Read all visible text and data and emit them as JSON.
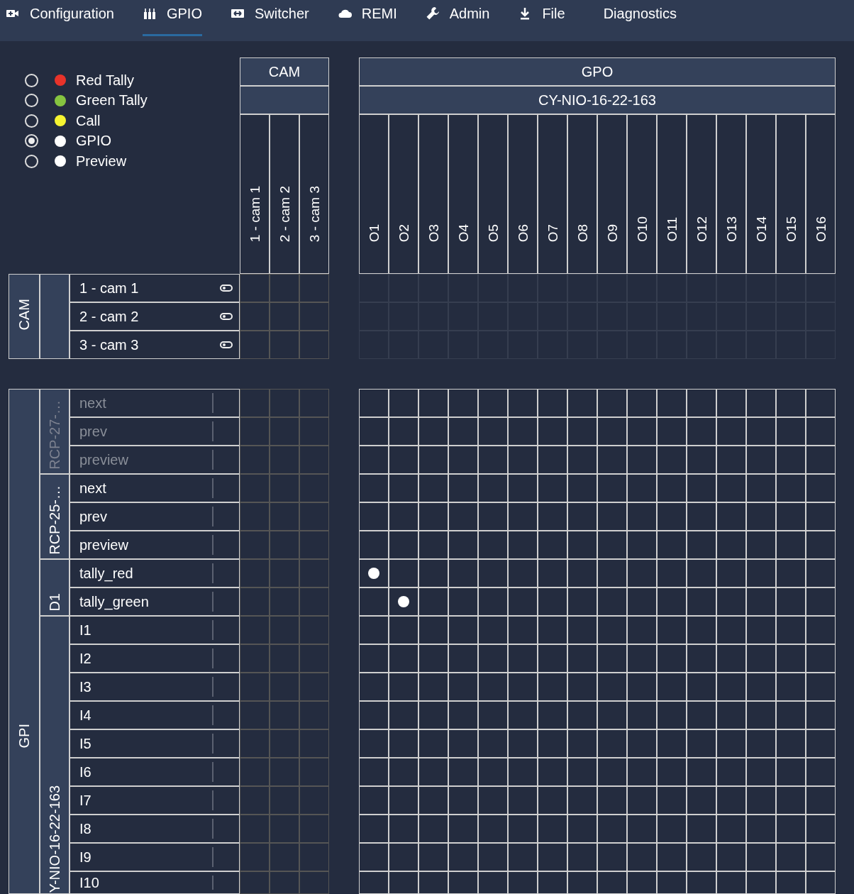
{
  "nav": [
    {
      "label": "Configuration",
      "selected": false
    },
    {
      "label": "GPIO",
      "selected": true
    },
    {
      "label": "Switcher",
      "selected": false
    },
    {
      "label": "REMI",
      "selected": false
    },
    {
      "label": "Admin",
      "selected": false
    },
    {
      "label": "File",
      "selected": false
    },
    {
      "label": "Diagnostics",
      "selected": false
    }
  ],
  "legend": [
    {
      "label": "Red Tally",
      "color": "#e8332a",
      "selected": false
    },
    {
      "label": "Green Tally",
      "color": "#86c440",
      "selected": false
    },
    {
      "label": "Call",
      "color": "#f6f531",
      "selected": false
    },
    {
      "label": "GPIO",
      "color": "#ffffff",
      "selected": true
    },
    {
      "label": "Preview",
      "color": "#ffffff",
      "selected": false
    }
  ],
  "cam_columns": {
    "title": "CAM",
    "columns": [
      "1 - cam 1",
      "2 - cam 2",
      "3 - cam 3"
    ]
  },
  "gpo": {
    "title": "GPO",
    "device": "CY-NIO-16-22-163",
    "outputs": [
      "O1",
      "O2",
      "O3",
      "O4",
      "O5",
      "O6",
      "O7",
      "O8",
      "O9",
      "O10",
      "O11",
      "O12",
      "O13",
      "O14",
      "O15",
      "O16"
    ]
  },
  "cam_rows": {
    "title": "CAM",
    "rows": [
      "1 - cam 1",
      "2 - cam 2",
      "3 - cam 3"
    ]
  },
  "gpi": {
    "title": "GPI",
    "groups": [
      {
        "name": "RCP-27-…",
        "disabled": true,
        "inputs": [
          {
            "label": "next",
            "connected": [
              false,
              false,
              false,
              false,
              false,
              false,
              false,
              false,
              false,
              false,
              false,
              false,
              false,
              false,
              false,
              false
            ]
          },
          {
            "label": "prev",
            "connected": [
              false,
              false,
              false,
              false,
              false,
              false,
              false,
              false,
              false,
              false,
              false,
              false,
              false,
              false,
              false,
              false
            ]
          },
          {
            "label": "preview",
            "connected": [
              false,
              false,
              false,
              false,
              false,
              false,
              false,
              false,
              false,
              false,
              false,
              false,
              false,
              false,
              false,
              false
            ]
          }
        ]
      },
      {
        "name": "RCP-25-…",
        "disabled": false,
        "inputs": [
          {
            "label": "next",
            "connected": [
              false,
              false,
              false,
              false,
              false,
              false,
              false,
              false,
              false,
              false,
              false,
              false,
              false,
              false,
              false,
              false
            ]
          },
          {
            "label": "prev",
            "connected": [
              false,
              false,
              false,
              false,
              false,
              false,
              false,
              false,
              false,
              false,
              false,
              false,
              false,
              false,
              false,
              false
            ]
          },
          {
            "label": "preview",
            "connected": [
              false,
              false,
              false,
              false,
              false,
              false,
              false,
              false,
              false,
              false,
              false,
              false,
              false,
              false,
              false,
              false
            ]
          }
        ]
      },
      {
        "name": "D1",
        "disabled": false,
        "inputs": [
          {
            "label": "tally_red",
            "connected": [
              true,
              false,
              false,
              false,
              false,
              false,
              false,
              false,
              false,
              false,
              false,
              false,
              false,
              false,
              false,
              false
            ]
          },
          {
            "label": "tally_green",
            "connected": [
              false,
              true,
              false,
              false,
              false,
              false,
              false,
              false,
              false,
              false,
              false,
              false,
              false,
              false,
              false,
              false
            ]
          }
        ]
      },
      {
        "name": "Y-NIO-16-22-163",
        "disabled": false,
        "inputs": [
          {
            "label": "I1",
            "connected": [
              false,
              false,
              false,
              false,
              false,
              false,
              false,
              false,
              false,
              false,
              false,
              false,
              false,
              false,
              false,
              false
            ]
          },
          {
            "label": "I2",
            "connected": [
              false,
              false,
              false,
              false,
              false,
              false,
              false,
              false,
              false,
              false,
              false,
              false,
              false,
              false,
              false,
              false
            ]
          },
          {
            "label": "I3",
            "connected": [
              false,
              false,
              false,
              false,
              false,
              false,
              false,
              false,
              false,
              false,
              false,
              false,
              false,
              false,
              false,
              false
            ]
          },
          {
            "label": "I4",
            "connected": [
              false,
              false,
              false,
              false,
              false,
              false,
              false,
              false,
              false,
              false,
              false,
              false,
              false,
              false,
              false,
              false
            ]
          },
          {
            "label": "I5",
            "connected": [
              false,
              false,
              false,
              false,
              false,
              false,
              false,
              false,
              false,
              false,
              false,
              false,
              false,
              false,
              false,
              false
            ]
          },
          {
            "label": "I6",
            "connected": [
              false,
              false,
              false,
              false,
              false,
              false,
              false,
              false,
              false,
              false,
              false,
              false,
              false,
              false,
              false,
              false
            ]
          },
          {
            "label": "I7",
            "connected": [
              false,
              false,
              false,
              false,
              false,
              false,
              false,
              false,
              false,
              false,
              false,
              false,
              false,
              false,
              false,
              false
            ]
          },
          {
            "label": "I8",
            "connected": [
              false,
              false,
              false,
              false,
              false,
              false,
              false,
              false,
              false,
              false,
              false,
              false,
              false,
              false,
              false,
              false
            ]
          },
          {
            "label": "I9",
            "connected": [
              false,
              false,
              false,
              false,
              false,
              false,
              false,
              false,
              false,
              false,
              false,
              false,
              false,
              false,
              false,
              false
            ]
          },
          {
            "label": "I10",
            "connected": [
              false,
              false,
              false,
              false,
              false,
              false,
              false,
              false,
              false,
              false,
              false,
              false,
              false,
              false,
              false,
              false
            ]
          }
        ]
      }
    ]
  }
}
